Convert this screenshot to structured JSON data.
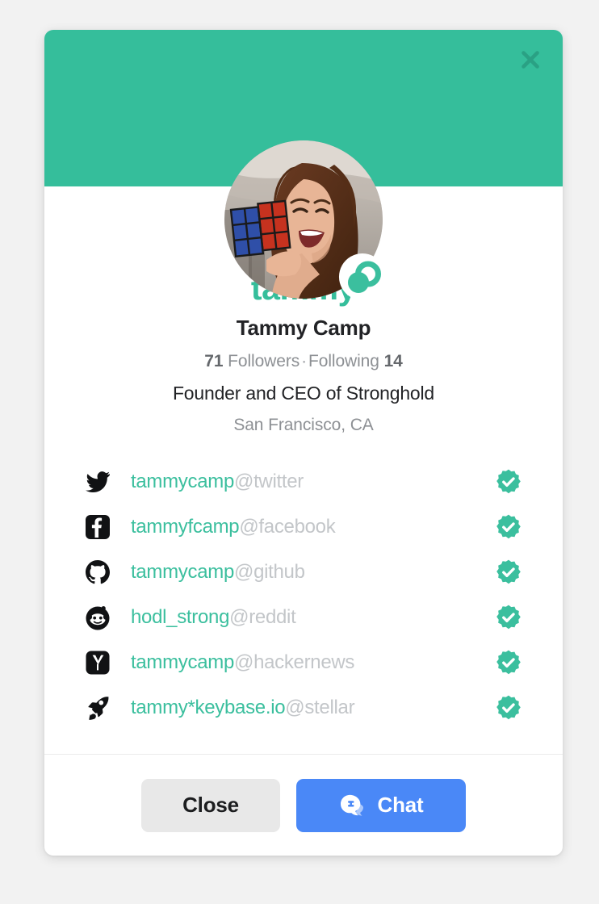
{
  "card": {
    "close_icon": "close-x-icon",
    "avatar_badge_icon": "keybase-badge-icon",
    "avatar_alt": "profile-photo"
  },
  "profile": {
    "username": "tammy",
    "full_name": "Tammy Camp",
    "followers_count": "71",
    "followers_label": "Followers",
    "separator": "·",
    "following_label": "Following",
    "following_count": "14",
    "bio": "Founder and CEO of Stronghold",
    "location": "San Francisco, CA"
  },
  "proofs": [
    {
      "icon": "twitter-icon",
      "name": "tammycamp",
      "service": "@twitter",
      "verified_icon": "verified-check-icon"
    },
    {
      "icon": "facebook-icon",
      "name": "tammyfcamp",
      "service": "@facebook",
      "verified_icon": "verified-check-icon"
    },
    {
      "icon": "github-icon",
      "name": "tammycamp",
      "service": "@github",
      "verified_icon": "verified-check-icon"
    },
    {
      "icon": "reddit-icon",
      "name": "hodl_strong",
      "service": "@reddit",
      "verified_icon": "verified-check-icon"
    },
    {
      "icon": "hackernews-icon",
      "name": "tammycamp",
      "service": "@hackernews",
      "verified_icon": "verified-check-icon"
    },
    {
      "icon": "stellar-rocket-icon",
      "name": "tammy*keybase.io",
      "service": "@stellar",
      "verified_icon": "verified-check-icon"
    }
  ],
  "footer": {
    "close_label": "Close",
    "chat_label": "Chat",
    "chat_icon": "chat-bubbles-icon"
  },
  "colors": {
    "brand_green": "#35be9b",
    "accent_green": "#3bbf9e",
    "chat_blue": "#4a88f7",
    "close_gray": "#e8e8e8",
    "page_background": "#f2f2f2",
    "muted_text": "#8d9094",
    "service_text": "#c3c6c9"
  }
}
